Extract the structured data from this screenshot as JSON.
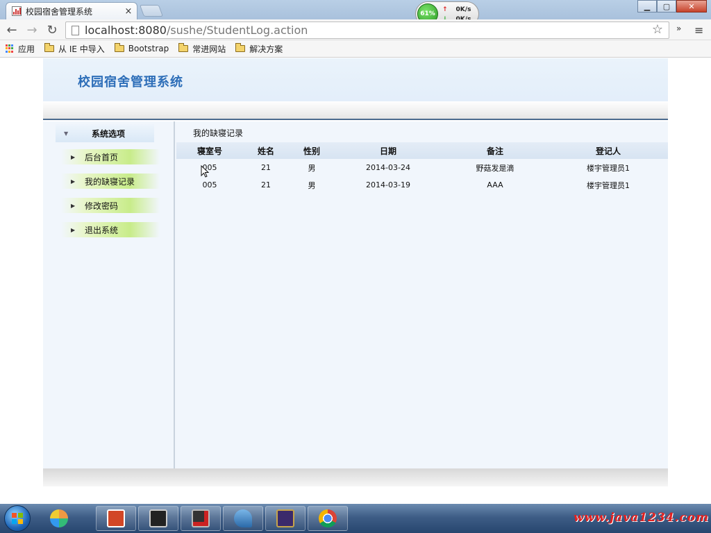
{
  "browser": {
    "tab_title": "校园宿舍管理系统",
    "tab_close": "×",
    "url_host": "localhost:8080",
    "url_path": "/sushe/StudentLog.action",
    "net_widget": {
      "cpu": "61%",
      "up": "0K/s",
      "down": "0K/s"
    },
    "bookmarks": [
      {
        "label": "应用",
        "icon": "apps-icon"
      },
      {
        "label": "从 IE 中导入",
        "icon": "folder-icon"
      },
      {
        "label": "Bootstrap",
        "icon": "folder-icon"
      },
      {
        "label": "常进网站",
        "icon": "folder-icon"
      },
      {
        "label": "解决方案",
        "icon": "folder-icon"
      }
    ]
  },
  "app": {
    "title": "校园宿舍管理系统",
    "sidebar": {
      "header": "系统选项",
      "items": [
        {
          "label": "后台首页"
        },
        {
          "label": "我的缺寝记录"
        },
        {
          "label": "修改密码"
        },
        {
          "label": "退出系统"
        }
      ]
    },
    "content": {
      "breadcrumb": "我的缺寝记录",
      "columns": [
        "寝室号",
        "姓名",
        "性别",
        "日期",
        "备注",
        "登记人"
      ],
      "rows": [
        [
          "005",
          "21",
          "男",
          "2014-03-24",
          "野菇发是滴",
          "楼宇管理员1"
        ],
        [
          "005",
          "21",
          "男",
          "2014-03-19",
          "AAA",
          "楼宇管理员1"
        ]
      ]
    }
  },
  "watermark": "www.java1234.com",
  "colors": {
    "accent": "#2d6eb8",
    "menu_highlight": "#c8ec8a",
    "taskbar": "#3e5d86"
  }
}
